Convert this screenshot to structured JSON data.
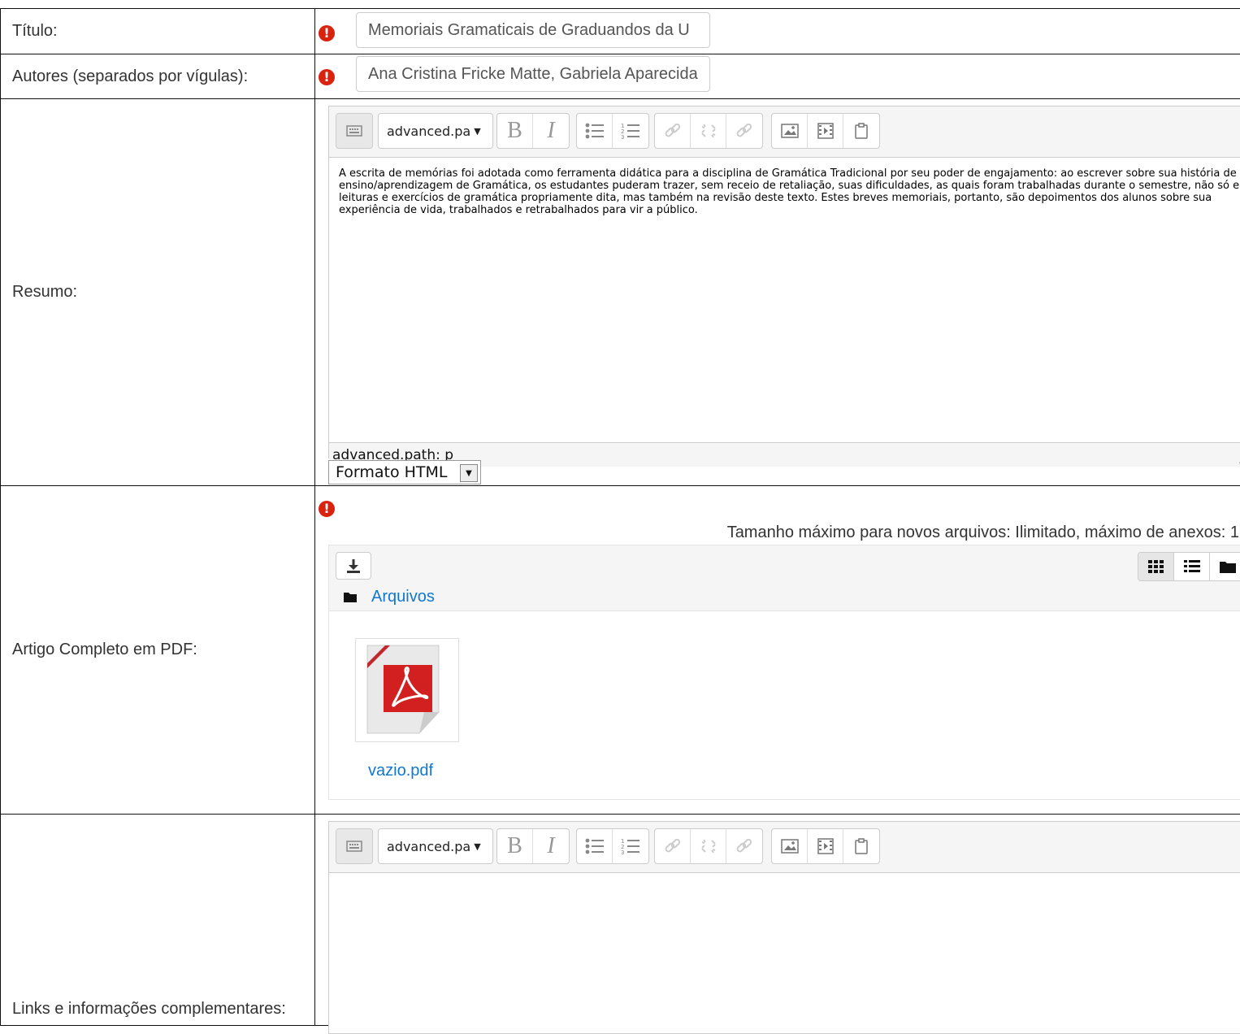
{
  "fields": {
    "titulo": {
      "label": "Título:",
      "value": "Memoriais Gramaticais de Graduandos da U"
    },
    "autores": {
      "label": "Autores (separados por vígulas):",
      "value": "Ana Cristina Fricke Matte, Gabriela Aparecida"
    },
    "resumo": {
      "label": "Resumo:",
      "text": "A escrita de memórias foi adotada como ferramenta didática para a disciplina de Gramática Tradicional por seu poder de engajamento: ao escrever sobre sua história de ensino/aprendizagem de Gramática, os estudantes puderam trazer, sem receio de retaliação, suas dificuldades, as quais foram trabalhadas durante o semestre, não só em leituras e exercícios de gramática propriamente dita, mas também na revisão deste texto. Estes breves memoriais, portanto, são depoimentos dos alunos sobre sua experiência de vida, trabalhados e retrabalhados para vir a público.",
      "path": "advanced.path: p",
      "format": "Formato HTML"
    },
    "artigo": {
      "label": "Artigo Completo em PDF:",
      "limits": "Tamanho máximo para novos arquivos: Ilimitado, máximo de anexos: 1",
      "folder": "Arquivos",
      "file": "vazio.pdf"
    },
    "links": {
      "label": "Links e informações complementares:"
    }
  },
  "toolbar": {
    "paragraph": "advanced.pa"
  },
  "icons": {
    "required": "exclamation-circle-icon",
    "kbd": "keyboard-icon",
    "bold": "bold-icon",
    "italic": "italic-icon",
    "ul": "bullet-list-icon",
    "ol": "numbered-list-icon",
    "link": "link-icon",
    "unlink": "unlink-icon",
    "anchor": "anchor-icon",
    "image": "image-icon",
    "media": "media-icon",
    "paste": "paste-icon",
    "download": "download-icon",
    "grid": "grid-view-icon",
    "list": "list-view-icon",
    "tree": "folder-view-icon",
    "pdf": "pdf-file-icon"
  },
  "colors": {
    "required": "#d9230f",
    "link": "#1177d1"
  }
}
